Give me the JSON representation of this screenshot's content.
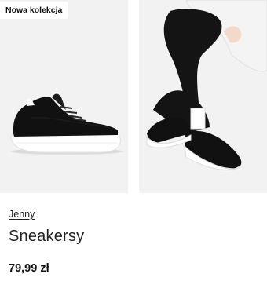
{
  "product": {
    "badge": "Nowa kolekcja",
    "brand": "Jenny",
    "name": "Sneakersy",
    "price": "79,99 zł",
    "images": [
      "shoe-side-view",
      "model-wearing-shoes"
    ]
  },
  "colors": {
    "image_background": "#f2f2f2",
    "shoe_upper": "#111111",
    "shoe_sole": "#ffffff",
    "legging": "#141414",
    "sweater": "#f4f4f4"
  }
}
